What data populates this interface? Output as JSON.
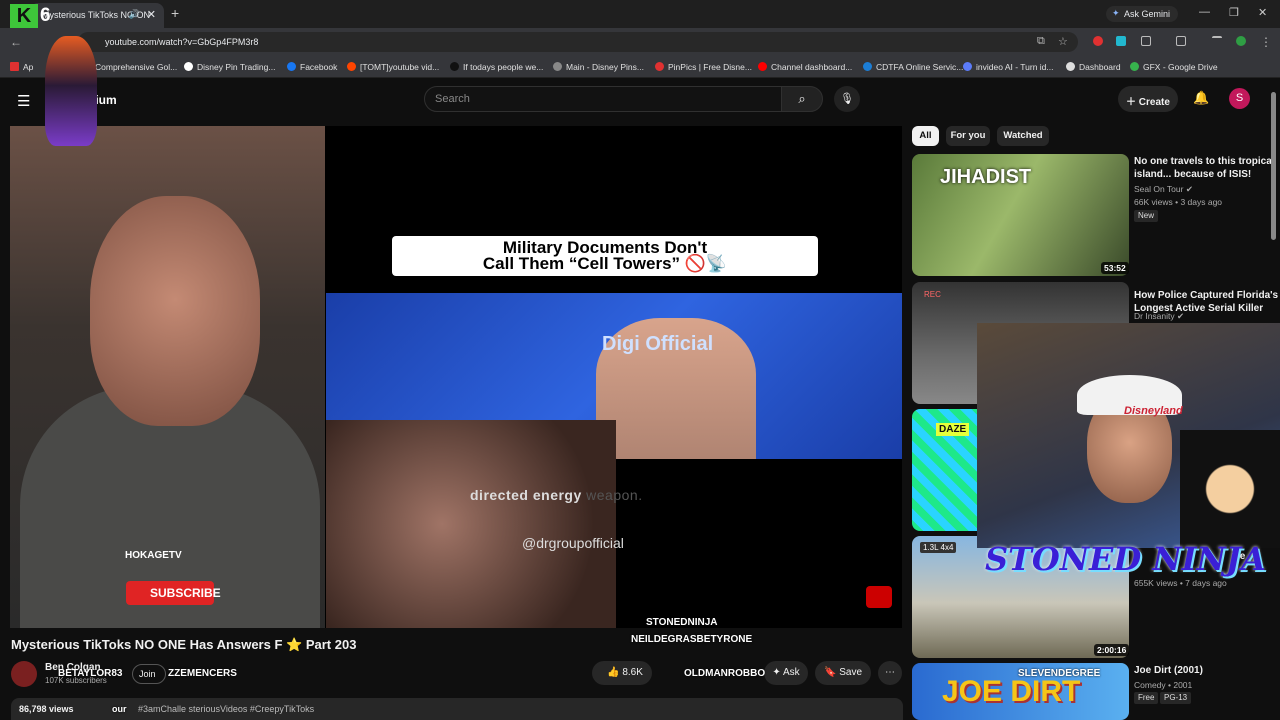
{
  "browser": {
    "tab_title": "Mysterious TikToks NO ON",
    "new_tab": "+",
    "ask_gemini": "Ask Gemini",
    "url": "youtube.com/watch?v=GbGp4FPM3r8",
    "bookmarks": [
      {
        "label": "Comprehensive Gol...",
        "color": "#2f9e44"
      },
      {
        "label": "Disney Pin Trading...",
        "color": "#ffffff"
      },
      {
        "label": "Facebook",
        "color": "#1877f2"
      },
      {
        "label": "[TOMT]youtube vid...",
        "color": "#ff4500"
      },
      {
        "label": "If todays people we...",
        "color": "#111111"
      },
      {
        "label": "Main - Disney Pins...",
        "color": "#888888"
      },
      {
        "label": "PinPics | Free Disne...",
        "color": "#e03131"
      },
      {
        "label": "Channel dashboard...",
        "color": "#ff0000"
      },
      {
        "label": "CDTFA Online Servic...",
        "color": "#1c7ed6"
      },
      {
        "label": "invideo AI - Turn id...",
        "color": "#5c7cfa"
      },
      {
        "label": "Dashboard",
        "color": "#dddddd"
      },
      {
        "label": "GFX - Google Drive",
        "color": "#37b24d"
      }
    ],
    "bookmark_first": "Ap"
  },
  "yt": {
    "logo_text": "nium",
    "search_placeholder": "Search",
    "create_label": "Create",
    "avatar_letter": "S"
  },
  "player": {
    "caption_line1": "Military Documents Don't",
    "caption_line2": "Call Them “Cell Towers” 🚫📡",
    "podcast_logo": "Digi Official",
    "subtitle_main": "directed energy",
    "subtitle_faded": "weapon.",
    "handle": "@drgroupofficial",
    "hokage": "HOKAGETV",
    "subscribe": "SUBSCRIBE"
  },
  "overlay": {
    "k": "K",
    "six": "6",
    "stoned_ninja": "STONED NINJA",
    "stonedninja_small": "STONEDNINJA",
    "neil": "NEILDEGRASBETYRONE",
    "oldman": "OLDMANROBBO",
    "zzemencers": "ZZEMENCERS",
    "betaylor": "BETAYLOR83",
    "sleven": "SLEVENDEGREE",
    "hat_text": "Disneyland"
  },
  "video": {
    "title": "Mysterious TikToks NO ONE Has Answers F",
    "title_part": "Part 203",
    "channel": "Ben Colgan",
    "subscribers": "107K subscribers",
    "join": "Join",
    "likes": "8.6K",
    "ask": "Ask",
    "save": "Save",
    "views": "86,798 views",
    "tags_prefix": "our",
    "tags": "#3amChalle   steriousVideos #CreepyTikToks"
  },
  "sidebar": {
    "chips": [
      "All",
      "For you",
      "Watched"
    ],
    "items": [
      {
        "title_1": "No one travels to this tropical",
        "title_2": "island... because of ISIS!",
        "channel": "Seal On Tour",
        "meta": "66K views • 3 days ago",
        "badge": "New",
        "duration": "53:52",
        "thumb_text": "JIHADIST"
      },
      {
        "title_1": "How Police Captured Florida's",
        "title_2": "Longest Active Serial Killer",
        "channel": "Dr Insanity",
        "meta": "",
        "badge": "",
        "duration": "",
        "thumb_text": "REC"
      },
      {
        "title_1": "",
        "title_2": "",
        "channel": "",
        "meta": "",
        "badge": "",
        "duration": "",
        "thumb_text": "DAZE"
      },
      {
        "title_1": "we",
        "title_2": "",
        "channel": "",
        "meta": "655K views • 7 days ago",
        "badge": "",
        "duration": "2:00:16",
        "thumb_text": "1.3L 4x4"
      },
      {
        "title_1": "Joe Dirt (2001)",
        "title_2": "",
        "channel": "Comedy • 2001",
        "meta": "",
        "badge": "Free",
        "badge2": "PG-13",
        "duration": "",
        "thumb_text": "JOE DIRT"
      }
    ]
  }
}
